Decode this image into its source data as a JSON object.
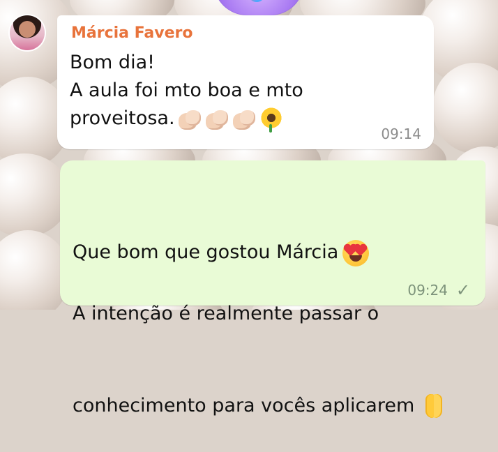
{
  "chat": {
    "incoming": {
      "sender": "Márcia Favero",
      "text": "Bom dia!\nA aula foi mto boa e mto\nproveitosa.",
      "emojis": [
        "clapping-hands",
        "clapping-hands",
        "clapping-hands",
        "sunflower"
      ],
      "time": "09:14"
    },
    "outgoing": {
      "line1": "Que bom que gostou Márcia",
      "line2": "A intenção é realmente passar o",
      "line3": "conhecimento para vocês aplicarem",
      "emojis": [
        "heart-eyes",
        "folded-hands"
      ],
      "time": "09:24",
      "status": "sent"
    }
  },
  "colors": {
    "sender_name": "#e8733b",
    "outgoing_bubble": "#e9fbd6",
    "incoming_bubble": "#ffffff"
  }
}
